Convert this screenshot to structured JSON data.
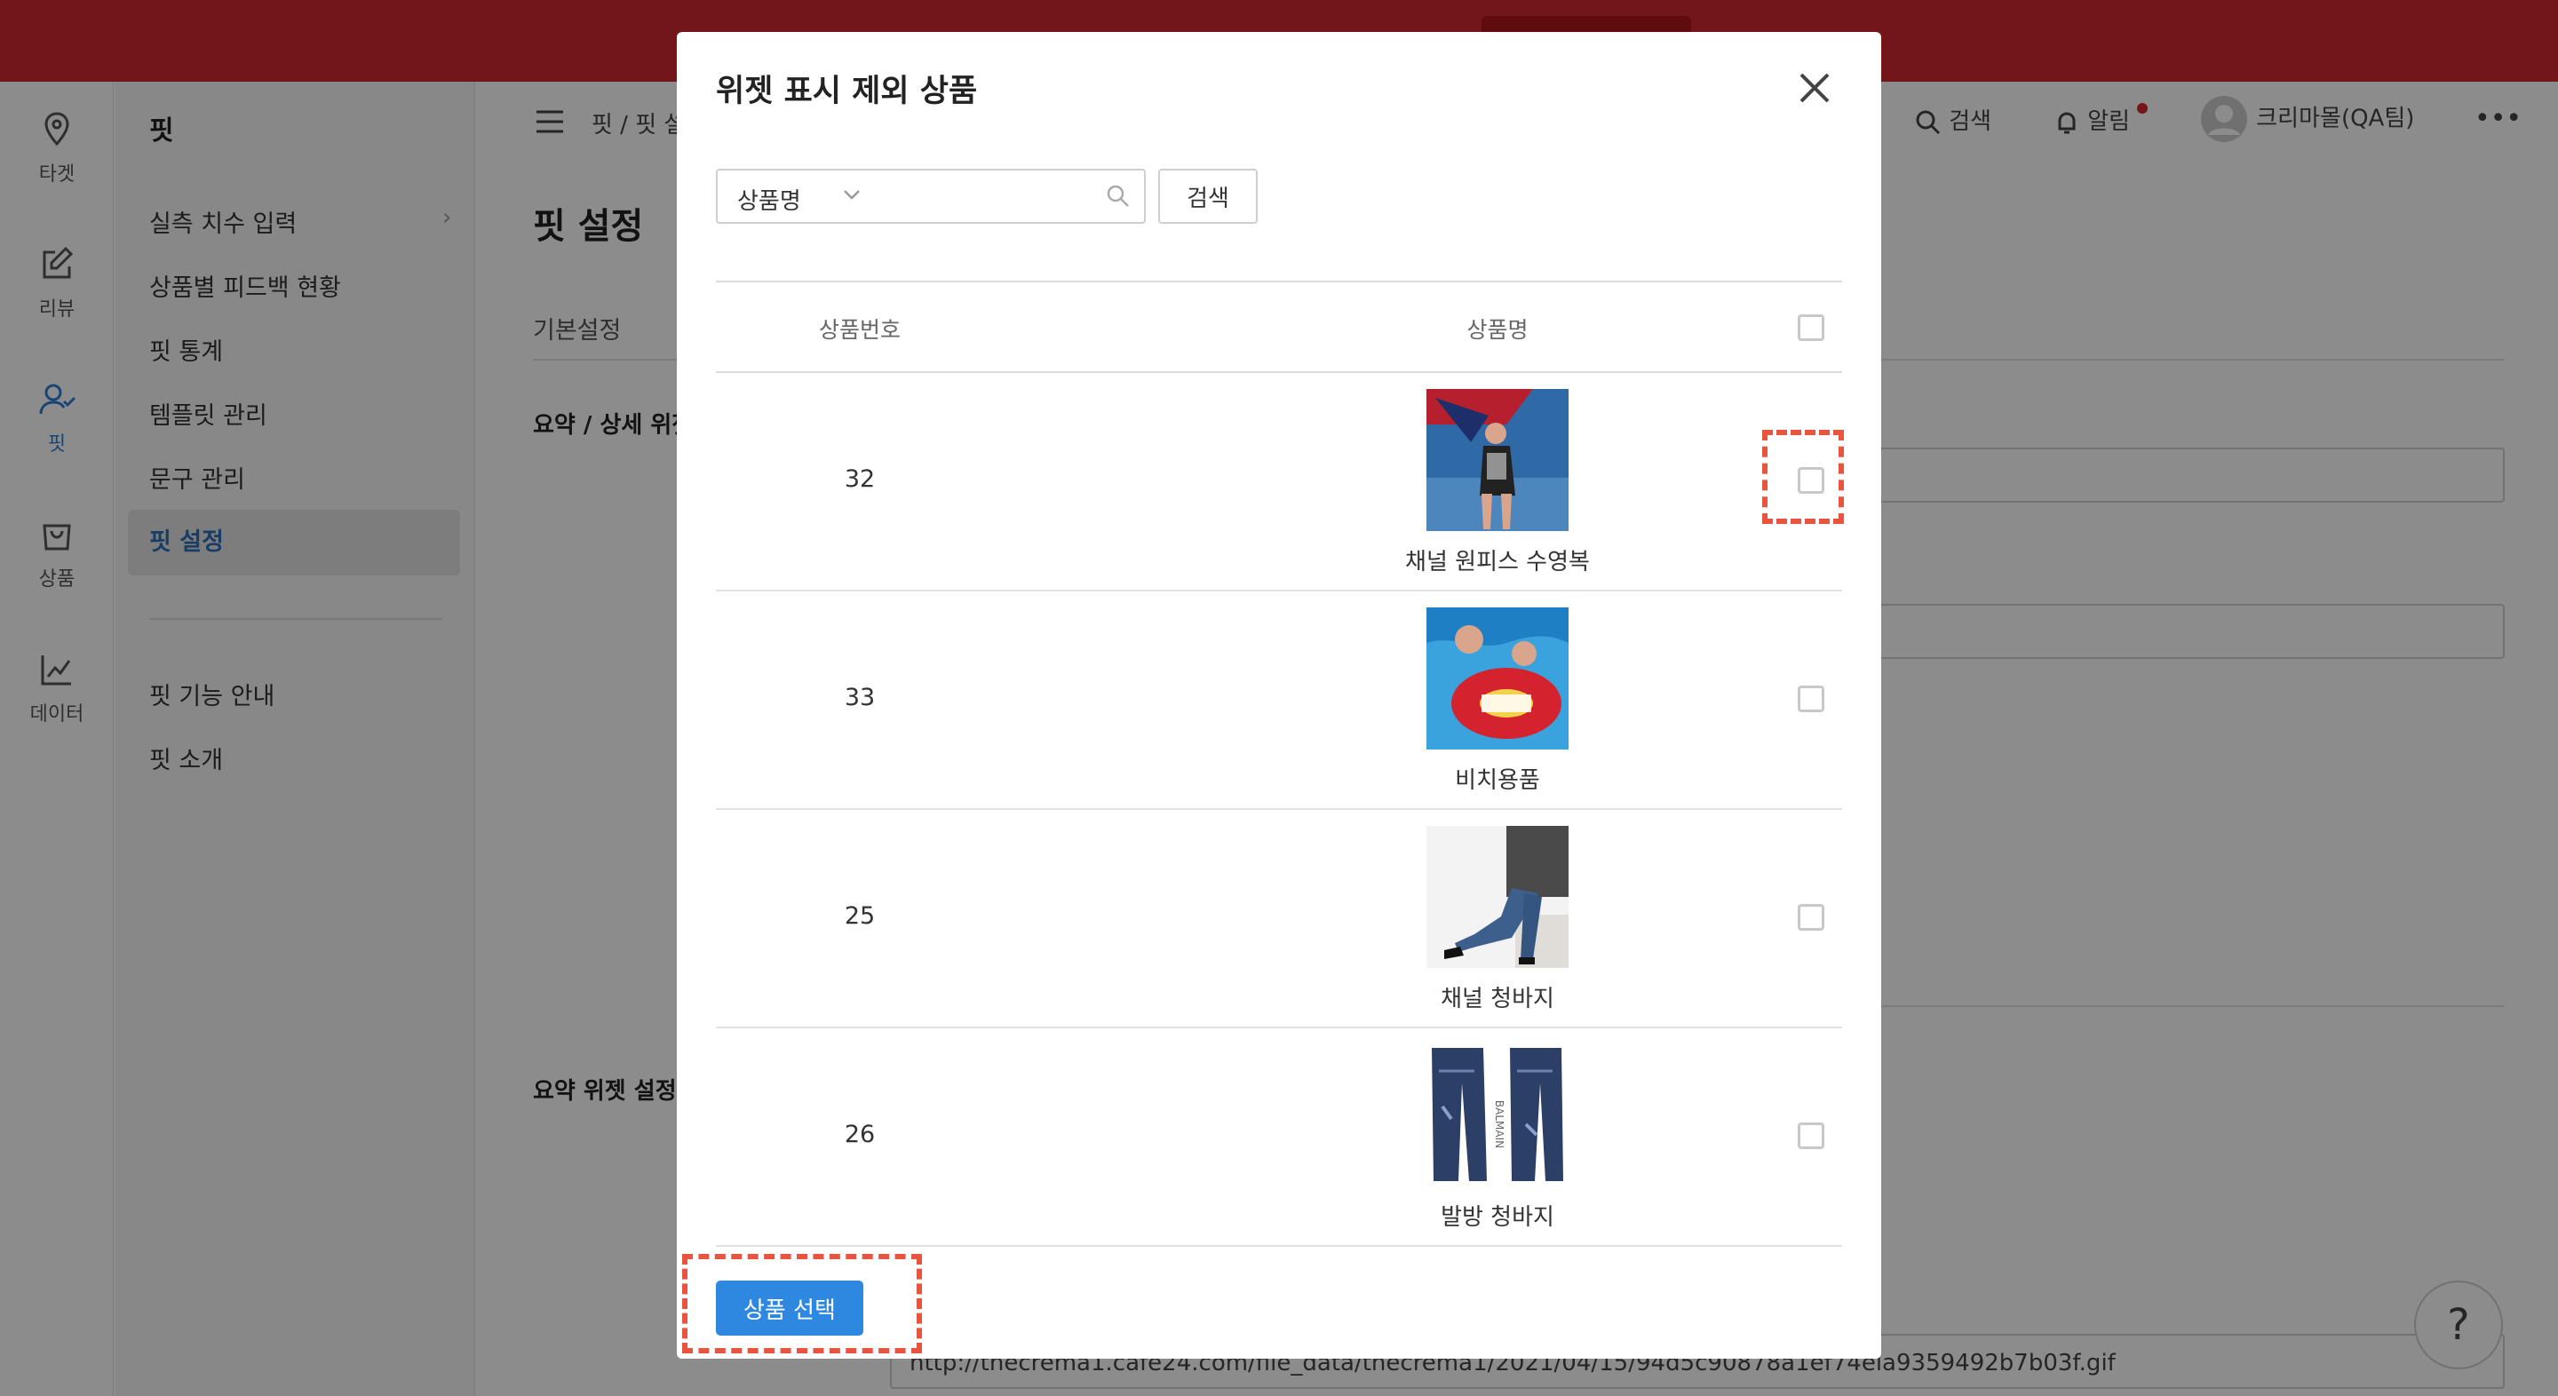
{
  "sidebar_icons": [
    {
      "label": "타겟",
      "icon": "location-pin-icon"
    },
    {
      "label": "리뷰",
      "icon": "edit-icon"
    },
    {
      "label": "핏",
      "icon": "user-check-icon"
    },
    {
      "label": "상품",
      "icon": "shopping-bag-icon"
    },
    {
      "label": "데이터",
      "icon": "line-chart-icon"
    }
  ],
  "submenu": {
    "title": "핏",
    "items": [
      "실측 치수 입력",
      "상품별 피드백 현황",
      "핏 통계",
      "템플릿 관리",
      "문구 관리",
      "핏 설정"
    ],
    "active": "핏 설정",
    "extra_items": [
      "핏 기능 안내",
      "핏 소개"
    ]
  },
  "header": {
    "breadcrumb": "핏 / 핏 설정",
    "search_label": "검색",
    "alert_label": "알림",
    "user_name": "크리마몰(QA팀)",
    "more_icon": "more-horizontal-icon"
  },
  "main": {
    "page_title": "핏 설정",
    "tab_basic": "기본설정",
    "section_summary_detail": "요약 / 상세 위젯",
    "section_summary_widget": "요약 위젯 설정",
    "url_value": "http://thecrema1.cafe24.com/file_data/thecrema1/2021/04/15/94d5c90878a1ef74ela9359492b7b03f.gif"
  },
  "modal": {
    "title": "위젯 표시 제외 상품",
    "search_select": "상품명",
    "search_placeholder": "",
    "search_button": "검색",
    "columns": [
      "상품번호",
      "상품명"
    ],
    "rows": [
      {
        "id": "32",
        "name": "채널 원피스 수영복",
        "image": "swimsuit-photo"
      },
      {
        "id": "33",
        "name": "비치용품",
        "image": "beach-float-photo"
      },
      {
        "id": "25",
        "name": "채널 청바지",
        "image": "jeans-model-photo"
      },
      {
        "id": "26",
        "name": "발방 청바지",
        "image": "jeans-photo"
      }
    ],
    "select_button": "상품 선택"
  },
  "colors": {
    "topbar": "#d0282e",
    "accent": "#2f88e0",
    "highlight": "#e8553f",
    "active_nav": "#2f7fd6"
  }
}
